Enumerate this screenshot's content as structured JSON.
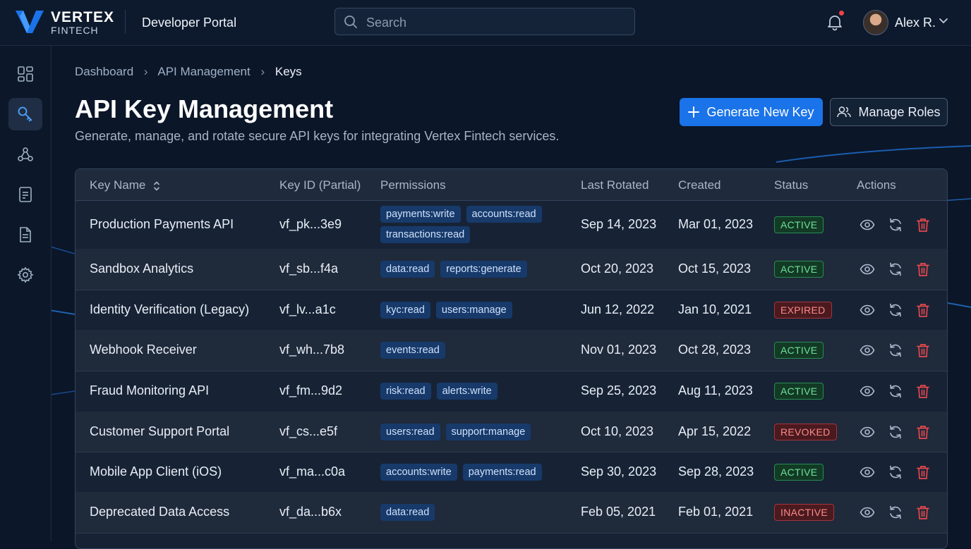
{
  "app": {
    "logo_line1": "VERTEX",
    "logo_line2": "FINTECH",
    "portal_title": "Developer Portal"
  },
  "search": {
    "placeholder": "Search"
  },
  "user": {
    "name": "Alex R."
  },
  "sidebar": {
    "items": [
      {
        "icon": "dashboard-grid-icon"
      },
      {
        "icon": "key-icon",
        "active": true
      },
      {
        "icon": "webhook-icon"
      },
      {
        "icon": "document-icon"
      },
      {
        "icon": "file-text-icon"
      },
      {
        "icon": "gear-icon"
      }
    ]
  },
  "breadcrumb": {
    "items": [
      "Dashboard",
      "API Management",
      "Keys"
    ]
  },
  "page": {
    "title": "API Key Management",
    "subtitle": "Generate, manage, and rotate secure API keys for integrating Vertex Fintech services."
  },
  "buttons": {
    "generate": "Generate New Key",
    "manage_roles": "Manage Roles"
  },
  "table": {
    "headers": [
      "Key Name",
      "Key ID (Partial)",
      "Permissions",
      "Last Rotated",
      "Created",
      "Status",
      "Actions"
    ],
    "rows": [
      {
        "name": "Production Payments API",
        "key_id": "vf_pk...3e9",
        "permissions": [
          "payments:write",
          "accounts:read",
          "transactions:read"
        ],
        "last_rotated": "Sep 14, 2023",
        "created": "Mar 01, 2023",
        "status": "ACTIVE"
      },
      {
        "name": "Sandbox Analytics",
        "key_id": "vf_sb...f4a",
        "permissions": [
          "data:read",
          "reports:generate"
        ],
        "last_rotated": "Oct 20, 2023",
        "created": "Oct 15, 2023",
        "status": "ACTIVE"
      },
      {
        "name": "Identity Verification (Legacy)",
        "key_id": "vf_lv...a1c",
        "permissions": [
          "kyc:read",
          "users:manage"
        ],
        "last_rotated": "Jun 12, 2022",
        "created": "Jan 10, 2021",
        "status": "EXPIRED"
      },
      {
        "name": "Webhook Receiver",
        "key_id": "vf_wh...7b8",
        "permissions": [
          "events:read"
        ],
        "last_rotated": "Nov 01, 2023",
        "created": "Oct 28, 2023",
        "status": "ACTIVE"
      },
      {
        "name": "Fraud Monitoring API",
        "key_id": "vf_fm...9d2",
        "permissions": [
          "risk:read",
          "alerts:write"
        ],
        "last_rotated": "Sep 25, 2023",
        "created": "Aug 11, 2023",
        "status": "ACTIVE"
      },
      {
        "name": "Customer Support Portal",
        "key_id": "vf_cs...e5f",
        "permissions": [
          "users:read",
          "support:manage"
        ],
        "last_rotated": "Oct 10, 2023",
        "created": "Apr 15, 2022",
        "status": "REVOKED"
      },
      {
        "name": "Mobile App Client (iOS)",
        "key_id": "vf_ma...c0a",
        "permissions": [
          "accounts:write",
          "payments:read"
        ],
        "last_rotated": "Sep 30, 2023",
        "created": "Sep 28, 2023",
        "status": "ACTIVE"
      },
      {
        "name": "Deprecated Data Access",
        "key_id": "vf_da...b6x",
        "permissions": [
          "data:read"
        ],
        "last_rotated": "Feb 05, 2021",
        "created": "Feb 01, 2021",
        "status": "INACTIVE"
      }
    ]
  },
  "colors": {
    "accent": "#1a73e8",
    "background": "#0b1628",
    "status_active": "#6fe09a",
    "status_error": "#ff8a8a",
    "delete_icon": "#e5484d"
  }
}
